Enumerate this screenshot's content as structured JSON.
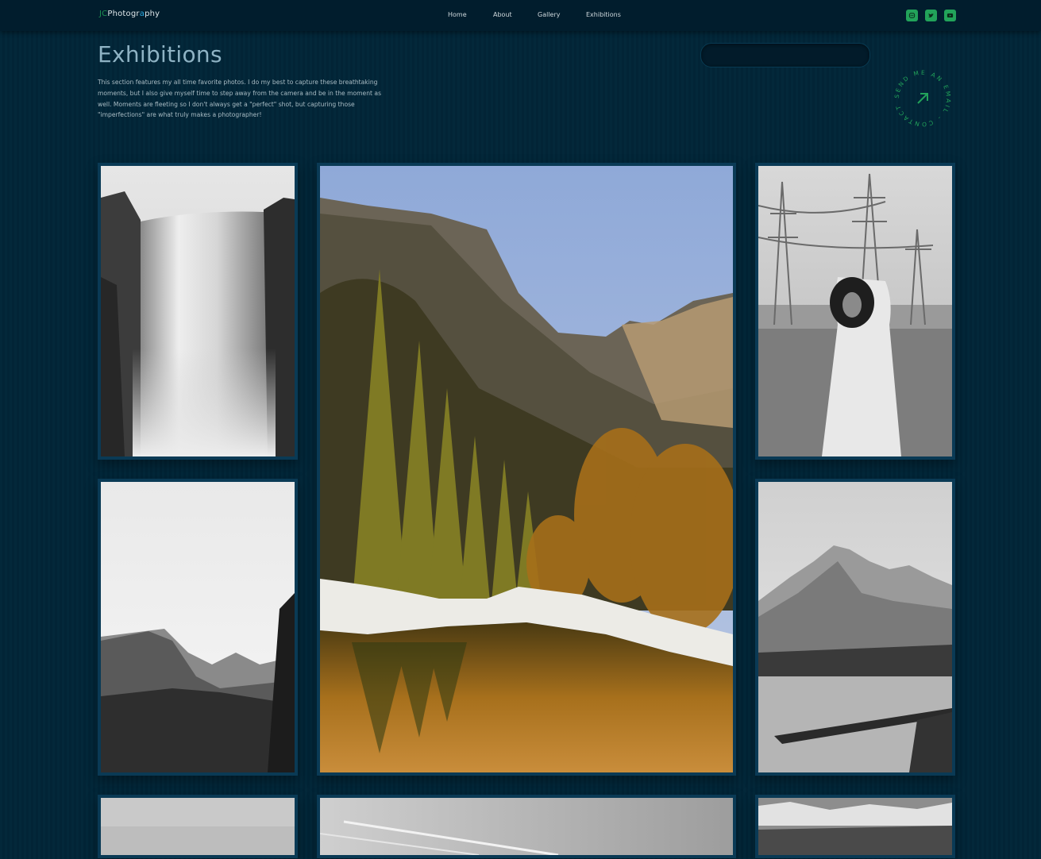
{
  "brand": {
    "prefix": "JC",
    "name_a": "Photogr",
    "name_b": "a",
    "name_c": "phy"
  },
  "nav": {
    "items": [
      "Home",
      "About",
      "Gallery",
      "Exhibitions"
    ]
  },
  "social": [
    "discord-icon",
    "twitter-icon",
    "youtube-icon"
  ],
  "header": {
    "title": "Exhibitions",
    "intro": "This section features my all time favorite photos. I do my best to capture these breathtaking moments, but I also give myself time to step away from the camera and be in the moment as well. Moments are fleeting so I don't always get a \"perfect\" shot, but capturing those \"imperfections\" are what truly makes a photographer!"
  },
  "search": {
    "placeholder": ""
  },
  "contact_badge": {
    "text": "SEND ME AN EMAIL - CONTACT - "
  },
  "gallery": {
    "photos": [
      "bw-waterfall-photo",
      "yosemite-valley-color-photo",
      "woman-power-lines-photo",
      "bw-mountain-ridge-photo",
      "bw-alpine-lake-photo",
      "bw-desert-photo",
      "bw-sky-contrails-photo",
      "bw-snowy-forest-photo"
    ]
  },
  "colors": {
    "accent": "#22a35a",
    "brand_accent": "#2aa8e0",
    "background": "#03283a",
    "frame": "#0a3a55"
  }
}
